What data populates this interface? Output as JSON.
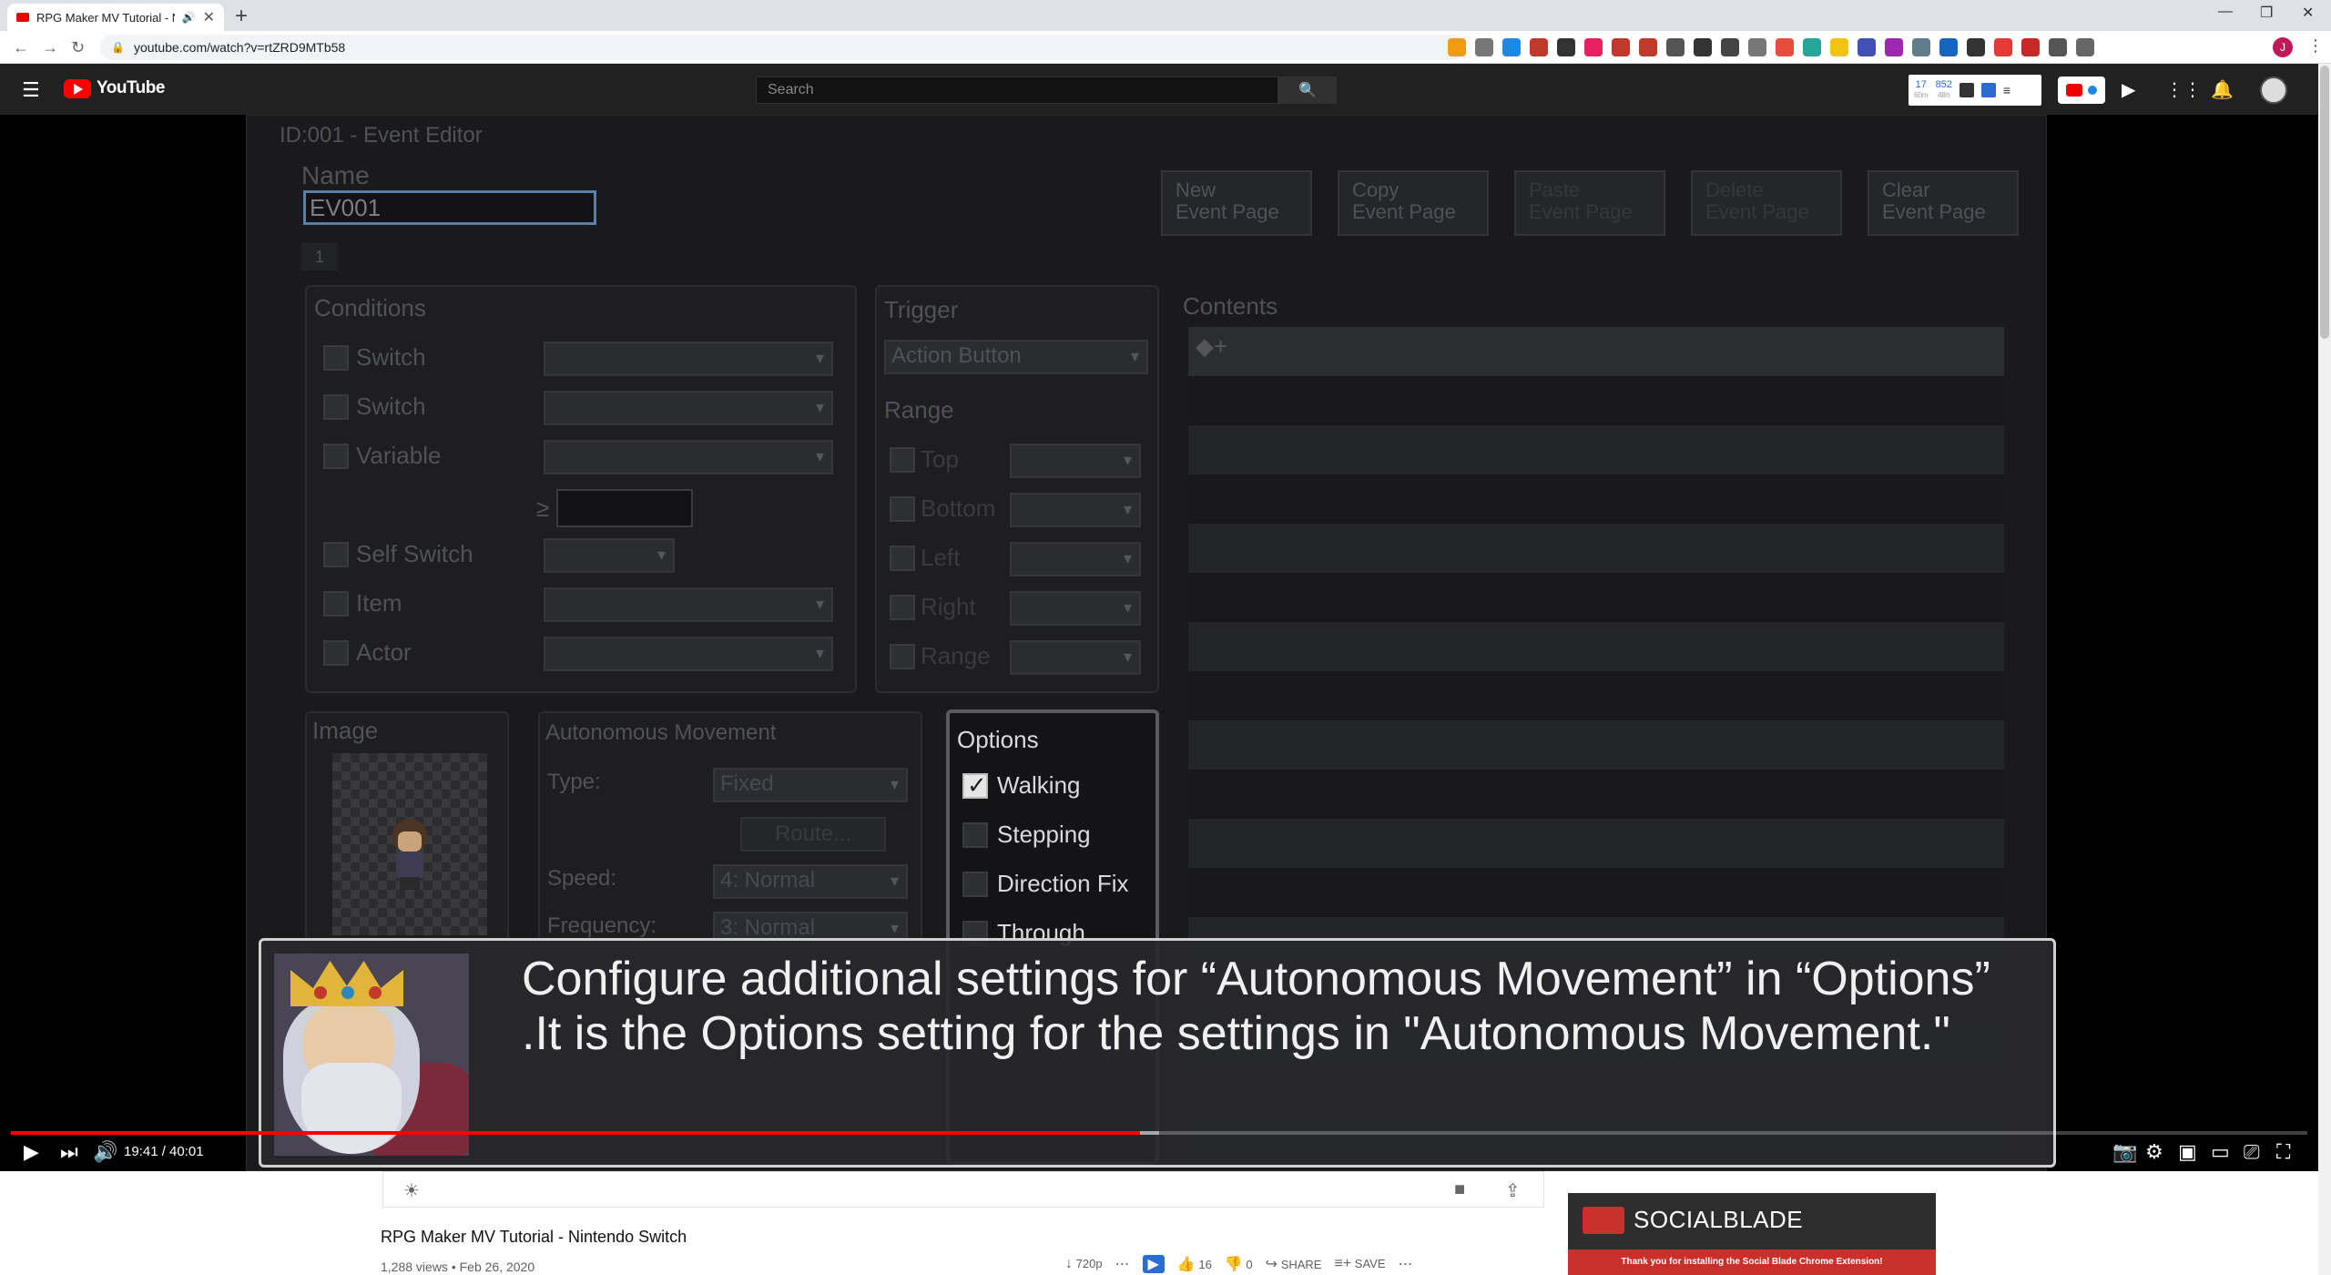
{
  "browser": {
    "tab_title": "RPG Maker MV Tutorial - Nin",
    "url": "youtube.com/watch?v=rtZRD9MTb58",
    "ext_colors": [
      "#f39c12",
      "#777",
      "#1e88e5",
      "#c0392b",
      "#333",
      "#e91e63",
      "#c0392b",
      "#c0392b",
      "#555",
      "#333",
      "#444",
      "#777",
      "#e74c3c",
      "#26a69a",
      "#f1c40f",
      "#3f51b5",
      "#9c27b0",
      "#607d8b",
      "#1565c0",
      "#333",
      "#e53935",
      "#c62828",
      "#555",
      "#666"
    ],
    "profile_initial": "J"
  },
  "youtube": {
    "logo_text": "YouTube",
    "search_placeholder": "Search",
    "socialblade": {
      "a": "17",
      "a_sub": "60m",
      "b": "852",
      "b_sub": "48h"
    }
  },
  "editor": {
    "title": "ID:001 - Event Editor",
    "name_label": "Name",
    "name_value": "EV001",
    "page_buttons": [
      {
        "l1": "New",
        "l2": "Event Page"
      },
      {
        "l1": "Copy",
        "l2": "Event Page"
      },
      {
        "l1": "Paste",
        "l2": "Event Page"
      },
      {
        "l1": "Delete",
        "l2": "Event Page"
      },
      {
        "l1": "Clear",
        "l2": "Event Page"
      }
    ],
    "page_tab": "1",
    "conditions_title": "Conditions",
    "conditions": [
      "Switch",
      "Switch",
      "Variable",
      "Self Switch",
      "Item",
      "Actor"
    ],
    "ge_symbol": "≥",
    "trigger_title": "Trigger",
    "trigger_value": "Action Button",
    "range_title": "Range",
    "range_items": [
      "Top",
      "Bottom",
      "Left",
      "Right",
      "Range"
    ],
    "contents_title": "Contents",
    "contents_marker": "◆+",
    "image_title": "Image",
    "auto_title": "Autonomous Movement",
    "type_label": "Type:",
    "type_value": "Fixed",
    "route_label": "Route...",
    "speed_label": "Speed:",
    "speed_value": "4: Normal",
    "freq_label": "Frequency:",
    "freq_value": "3: Normal",
    "options_title": "Options",
    "options": [
      {
        "label": "Walking",
        "checked": true
      },
      {
        "label": "Stepping",
        "checked": false
      },
      {
        "label": "Direction Fix",
        "checked": false
      },
      {
        "label": "Through",
        "checked": false
      }
    ]
  },
  "subtitle": {
    "text": "Configure additional settings for “Autonomous Movement”  in “Options” .It is the Options setting for the settings in \"Autonomous Movement.\""
  },
  "player": {
    "time": "19:41 / 40:01",
    "progress": 0.4917,
    "loaded": 0.5
  },
  "video": {
    "title": "RPG Maker MV Tutorial - Nintendo Switch",
    "meta": "1,288 views • Feb 26, 2020",
    "quality": "720p",
    "likes": "16",
    "dislikes": "0",
    "share_label": "SHARE",
    "save_label": "SAVE"
  },
  "socialblade_ad": {
    "name": "SOCIALBLADE",
    "banner": "Thank you for installing the Social Blade Chrome Extension!"
  }
}
